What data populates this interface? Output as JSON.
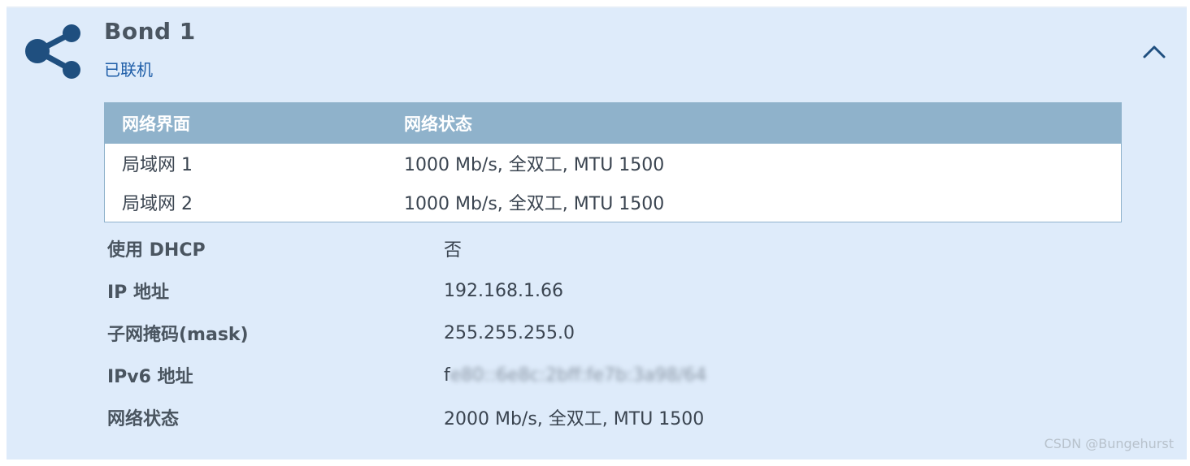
{
  "header": {
    "title": "Bond 1",
    "status": "已联机"
  },
  "interfaces_table": {
    "columns": [
      "网络界面",
      "网络状态"
    ],
    "rows": [
      [
        "局域网 1",
        "1000 Mb/s, 全双工, MTU 1500"
      ],
      [
        "局域网 2",
        "1000 Mb/s, 全双工, MTU 1500"
      ]
    ]
  },
  "details": [
    {
      "label": "使用 DHCP",
      "value": "否"
    },
    {
      "label": "IP 地址",
      "value": "192.168.1.66"
    },
    {
      "label": "子网掩码(mask)",
      "value": "255.255.255.0"
    },
    {
      "label": "IPv6 地址",
      "value_prefix": "f",
      "value_redacted": "e80::6e8c:2bff:fe7b:3a98/64"
    },
    {
      "label": "网络状态",
      "value": "2000 Mb/s, 全双工, MTU 1500"
    }
  ],
  "watermark": "CSDN @Bungehurst",
  "icons": {
    "bond": "share-network-icon",
    "collapse": "chevron-up-icon"
  },
  "colors": {
    "panel_bg": "#deebfa",
    "header_row": "#8fb2cb",
    "status_link": "#1f5ea8",
    "icon": "#1f4f7f"
  }
}
